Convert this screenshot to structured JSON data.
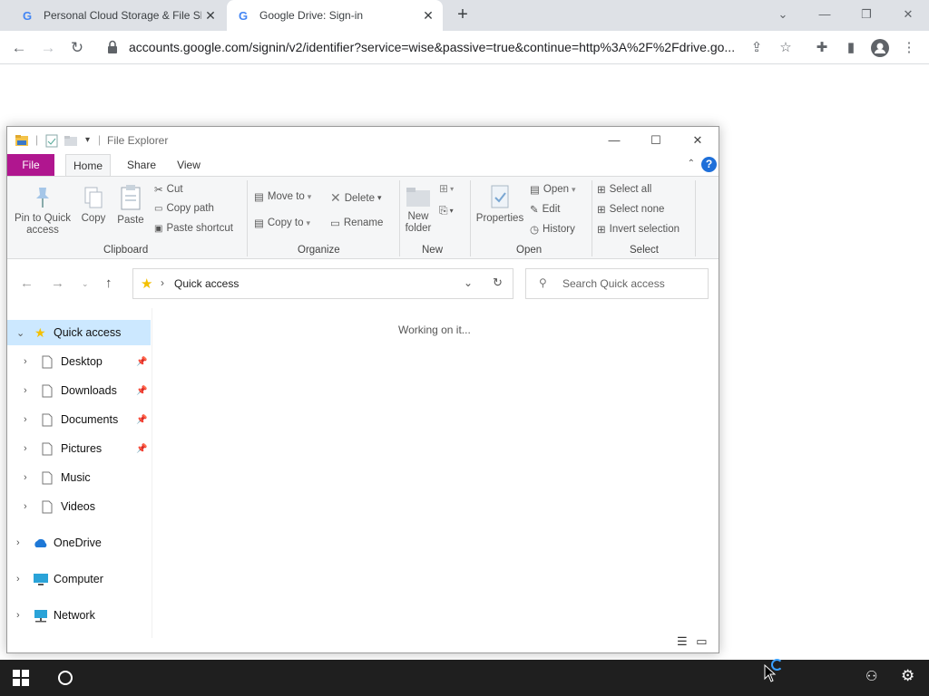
{
  "browser": {
    "tabs": [
      {
        "title": "Personal Cloud Storage & File Sh",
        "favicon": "google-g"
      },
      {
        "title": "Google Drive: Sign-in",
        "favicon": "google-g"
      }
    ],
    "address": "accounts.google.com/signin/v2/identifier?service=wise&passive=true&continue=http%3A%2F%2Fdrive.go..."
  },
  "explorer": {
    "title": "File Explorer",
    "ribbon_tabs": {
      "file": "File",
      "home": "Home",
      "share": "Share",
      "view": "View"
    },
    "clipboard": {
      "pin": "Pin to Quick access",
      "copy": "Copy",
      "paste": "Paste",
      "cut": "Cut",
      "copy_path": "Copy path",
      "paste_shortcut": "Paste shortcut",
      "label": "Clipboard"
    },
    "organize": {
      "move_to": "Move to",
      "copy_to": "Copy to",
      "delete": "Delete",
      "rename": "Rename",
      "label": "Organize"
    },
    "new": {
      "new_folder": "New folder",
      "label": "New"
    },
    "open": {
      "properties": "Properties",
      "open": "Open",
      "edit": "Edit",
      "history": "History",
      "label": "Open"
    },
    "select": {
      "select_all": "Select all",
      "select_none": "Select none",
      "invert_selection": "Invert selection",
      "label": "Select"
    },
    "address": "Quick access",
    "search_placeholder": "Search Quick access",
    "nav": {
      "quick_access": "Quick access",
      "pinned": [
        "Desktop",
        "Downloads",
        "Documents",
        "Pictures"
      ],
      "unpinned": [
        "Music",
        "Videos"
      ],
      "onedrive": "OneDrive",
      "computer": "Computer",
      "network": "Network"
    },
    "status_message": "Working on it..."
  },
  "colors": {
    "file_tab": "#b0168f",
    "selection": "#cce8ff",
    "taskbar": "#1f1f1f"
  }
}
